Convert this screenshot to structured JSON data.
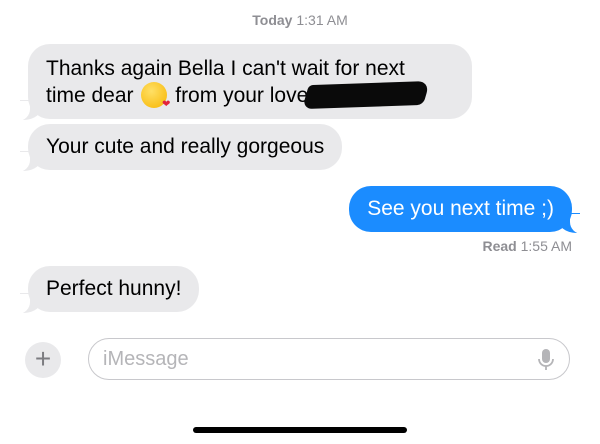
{
  "header": {
    "timestamp_day": "Today",
    "timestamp_time": "1:31 AM"
  },
  "messages": [
    {
      "direction": "incoming",
      "line1": "Thanks again Bella I can't wait for next",
      "line2_before_emoji": "time dear",
      "emoji": "face-blowing-a-kiss",
      "line2_after_emoji": "from your love",
      "redacted": true
    },
    {
      "direction": "incoming",
      "text": "Your cute and really gorgeous"
    },
    {
      "direction": "outgoing",
      "text": "See you next time ;)"
    },
    {
      "direction": "incoming",
      "text": "Perfect hunny!"
    }
  ],
  "read_receipt": {
    "label": "Read",
    "time": "1:55 AM"
  },
  "composer": {
    "add_button": "+",
    "placeholder": "iMessage",
    "value": "",
    "mic_icon": "microphone-icon"
  },
  "colors": {
    "incoming_bubble": "#e9e9eb",
    "outgoing_bubble": "#1b8cff",
    "meta_text": "#8e8e93"
  }
}
